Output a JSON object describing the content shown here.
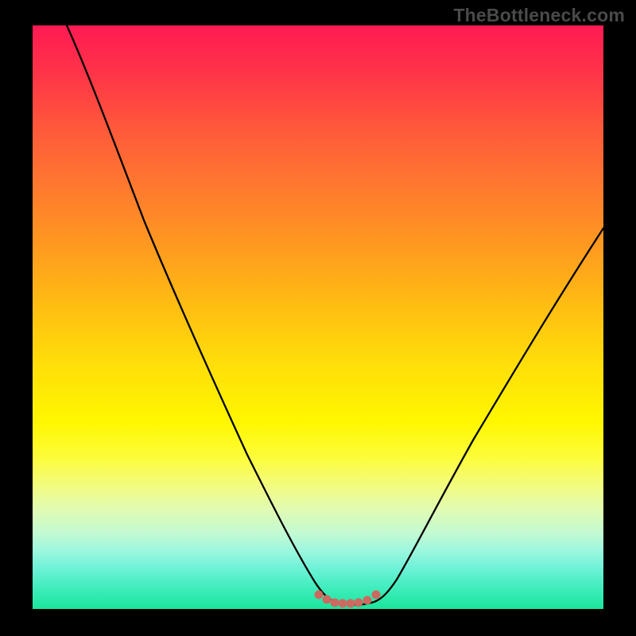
{
  "watermark": "TheBottleneck.com",
  "chart_data": {
    "type": "line",
    "title": "",
    "xlabel": "",
    "ylabel": "",
    "xlim": [
      0,
      100
    ],
    "ylim": [
      0,
      100
    ],
    "background_gradient": {
      "top": "#ff1a53",
      "bottom": "#1ae69b",
      "description": "vertical red-to-green gradient"
    },
    "series": [
      {
        "name": "bottleneck-curve",
        "x": [
          6,
          15,
          25,
          35,
          42,
          47,
          50,
          54,
          58,
          60,
          64,
          72,
          82,
          92,
          100
        ],
        "y": [
          100,
          82,
          60,
          38,
          22,
          10,
          3,
          1,
          1,
          3,
          10,
          24,
          41,
          56,
          68
        ]
      }
    ],
    "annotations": [
      {
        "name": "valley-bumps",
        "type": "markers",
        "color": "#cc6a61",
        "x": [
          50,
          51.5,
          53,
          54.5,
          56,
          57.5,
          59,
          60.5
        ],
        "y": [
          2.2,
          1.4,
          1.0,
          0.9,
          0.9,
          1.0,
          1.3,
          2.1
        ]
      }
    ]
  }
}
